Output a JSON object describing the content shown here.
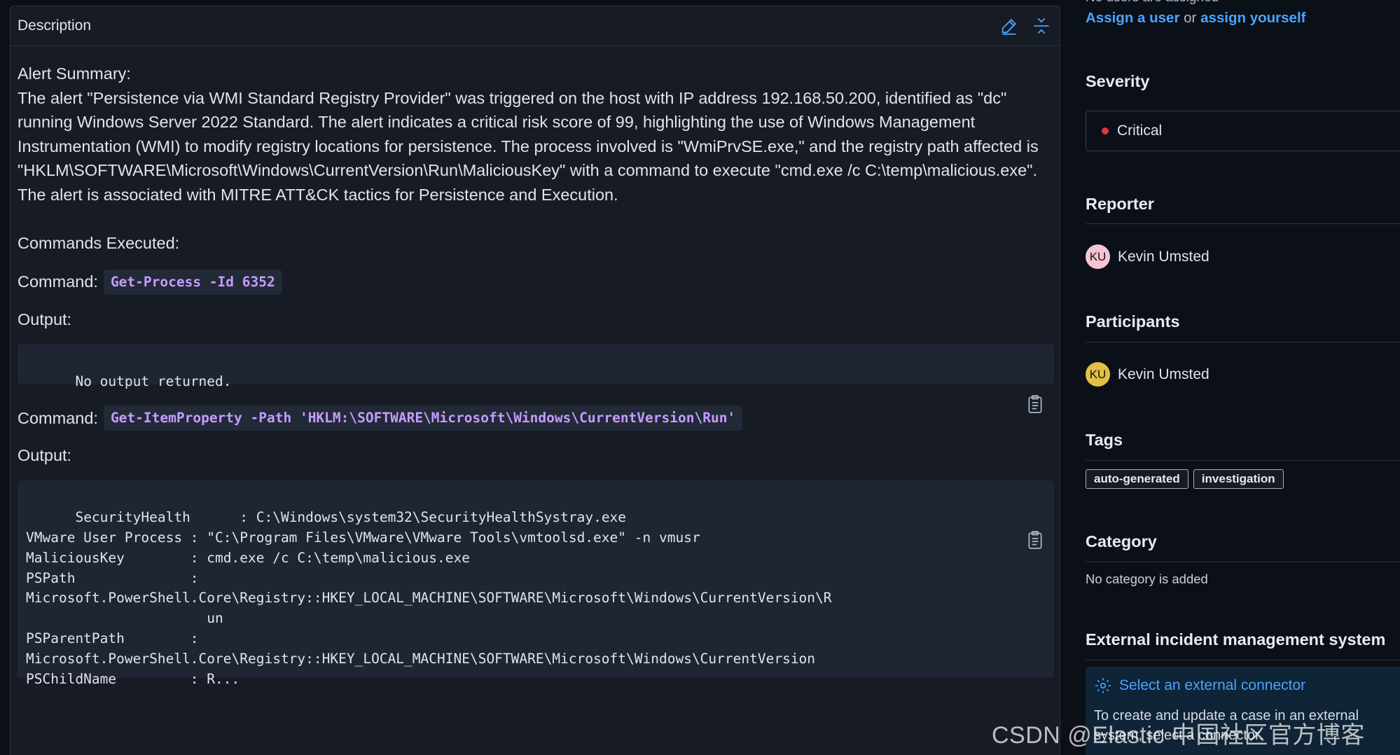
{
  "description": {
    "title": "Description",
    "alert_summary_heading": "Alert Summary:",
    "alert_summary_text": "The alert \"Persistence via WMI Standard Registry Provider\" was triggered on the host with IP address 192.168.50.200, identified as \"dc\" running Windows Server 2022 Standard. The alert indicates a critical risk score of 99, highlighting the use of Windows Management Instrumentation (WMI) to modify registry locations for persistence. The process involved is \"WmiPrvSE.exe,\" and the registry path affected is \"HKLM\\SOFTWARE\\Microsoft\\Windows\\CurrentVersion\\Run\\MaliciousKey\" with a command to execute \"cmd.exe /c C:\\temp\\malicious.exe\". The alert is associated with MITRE ATT&CK tactics for Persistence and Execution.",
    "commands_heading": "Commands Executed:",
    "command_label": "Command:",
    "output_label": "Output:",
    "commands": [
      {
        "command": "Get-Process -Id 6352",
        "output": "No output returned."
      },
      {
        "command": "Get-ItemProperty -Path 'HKLM:\\SOFTWARE\\Microsoft\\Windows\\CurrentVersion\\Run'",
        "output": "SecurityHealth      : C:\\Windows\\system32\\SecurityHealthSystray.exe\nVMware User Process : \"C:\\Program Files\\VMware\\VMware Tools\\vmtoolsd.exe\" -n vmusr\nMaliciousKey        : cmd.exe /c C:\\temp\\malicious.exe\nPSPath              :\nMicrosoft.PowerShell.Core\\Registry::HKEY_LOCAL_MACHINE\\SOFTWARE\\Microsoft\\Windows\\CurrentVersion\\R\n                      un\nPSParentPath        :\nMicrosoft.PowerShell.Core\\Registry::HKEY_LOCAL_MACHINE\\SOFTWARE\\Microsoft\\Windows\\CurrentVersion\nPSChildName         : R..."
      }
    ]
  },
  "sidebar": {
    "assignees_empty": "No users are assigned",
    "assign_user_link": "Assign a user",
    "assign_or": "or",
    "assign_yourself_link": "assign yourself",
    "severity": {
      "title": "Severity",
      "value": "Critical",
      "color": "#e7323b"
    },
    "reporter": {
      "title": "Reporter",
      "name": "Kevin Umsted",
      "initials": "KU",
      "avatar_color": "#f7c3d2"
    },
    "participants": {
      "title": "Participants",
      "name": "Kevin Umsted",
      "initials": "KU",
      "avatar_color": "#e2c044"
    },
    "tags": {
      "title": "Tags",
      "items": [
        "auto-generated",
        "investigation"
      ]
    },
    "category": {
      "title": "Category",
      "empty": "No category is added"
    },
    "external": {
      "title": "External incident management system",
      "connector_link": "Select an external connector",
      "connector_text": "To create and update a case in an external system, select a connector."
    }
  },
  "watermark": "CSDN @Elastic 中国社区官方博客"
}
